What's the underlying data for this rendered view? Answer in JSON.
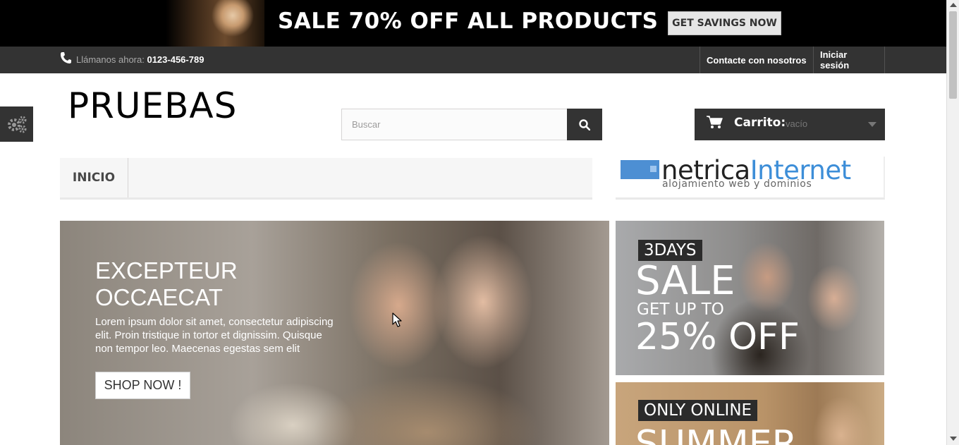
{
  "promo": {
    "headline": "SALE 70% OFF ALL PRODUCTS",
    "button": "GET SAVINGS NOW"
  },
  "nav": {
    "call_label": "Llámanos ahora:",
    "phone": "0123-456-789",
    "contact": "Contacte con nosotros",
    "login": "Iniciar sesión"
  },
  "header": {
    "logo": "PRUEBAS",
    "search_placeholder": "Buscar",
    "cart_label": "Carrito:",
    "cart_state": "vacío"
  },
  "menu": {
    "items": [
      {
        "label": "INICIO"
      }
    ]
  },
  "sponsor": {
    "name_part1": "netrica",
    "name_part2": "Internet",
    "tagline": "alojamiento web y dominios"
  },
  "slider": {
    "title_line1": "EXCEPTEUR",
    "title_line2": "OCCAECAT",
    "text": "Lorem ipsum dolor sit amet, consectetur adipiscing elit. Proin tristique in tortor et dignissim. Quisque non tempor leo. Maecenas egestas sem elit",
    "button": "SHOP NOW !"
  },
  "banners": {
    "first": {
      "tag": "3DAYS",
      "sale": "SALE",
      "up": "GET UP TO",
      "off": "25% OFF"
    },
    "second": {
      "tag": "ONLY ONLINE",
      "summer": "SUMMER"
    }
  },
  "icons": {
    "phone": "phone-icon",
    "gear": "gear-icon",
    "search": "search-icon",
    "cart": "cart-icon",
    "caret": "chevron-down-icon"
  }
}
